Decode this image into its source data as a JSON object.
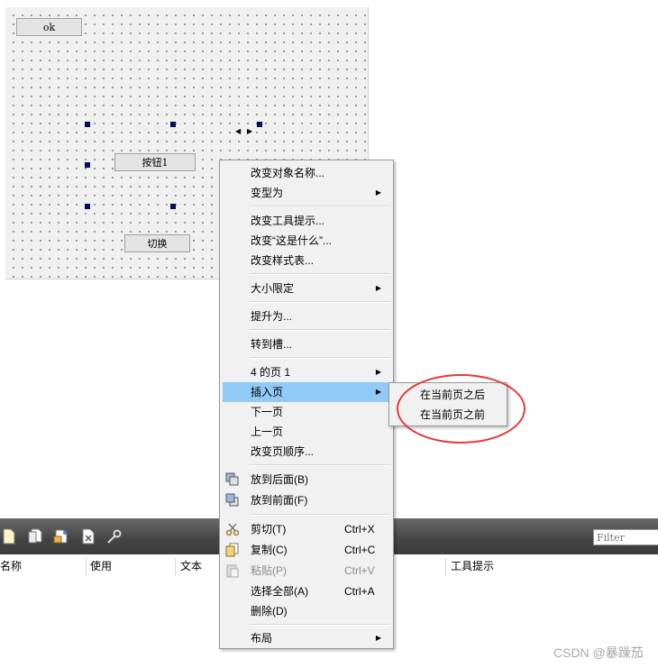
{
  "canvas": {
    "ok_button": "ok",
    "button1": "按钮1",
    "switch_button": "切换"
  },
  "menu": {
    "items": [
      {
        "label": "改变对象名称..."
      },
      {
        "label": "变型为",
        "submenu": true
      },
      {
        "label": "改变工具提示..."
      },
      {
        "label": "改变“这是什么”..."
      },
      {
        "label": "改变样式表..."
      },
      {
        "label": "大小限定",
        "submenu": true
      },
      {
        "label": "提升为..."
      },
      {
        "label": "转到槽..."
      },
      {
        "label": "4 的页 1",
        "submenu": true
      },
      {
        "label": "插入页",
        "submenu": true,
        "highlighted": true
      },
      {
        "label": "下一页"
      },
      {
        "label": "上一页"
      },
      {
        "label": "改变页顺序..."
      },
      {
        "label": "放到后面(B)",
        "icon": "send-back-icon"
      },
      {
        "label": "放到前面(F)",
        "icon": "bring-front-icon"
      },
      {
        "label": "剪切(T)",
        "shortcut": "Ctrl+X",
        "icon": "scissors-icon"
      },
      {
        "label": "复制(C)",
        "shortcut": "Ctrl+C",
        "icon": "copy-icon"
      },
      {
        "label": "粘贴(P)",
        "shortcut": "Ctrl+V",
        "icon": "paste-icon",
        "disabled": true
      },
      {
        "label": "选择全部(A)",
        "shortcut": "Ctrl+A"
      },
      {
        "label": "删除(D)"
      },
      {
        "label": "布局",
        "submenu": true
      }
    ],
    "submenu_items": [
      "在当前页之后",
      "在当前页之前"
    ],
    "highlight_color": "#91c9f7"
  },
  "panel": {
    "filter_placeholder": "Filter",
    "columns": [
      "名称",
      "使用",
      "文本",
      "工具提示"
    ],
    "toolbar_icons": [
      "new-action-icon",
      "copy-action-icon",
      "open-icon",
      "delete-icon",
      "wrench-icon"
    ]
  },
  "annotation_color": "#e53935",
  "watermark": "CSDN @暴躁茄"
}
